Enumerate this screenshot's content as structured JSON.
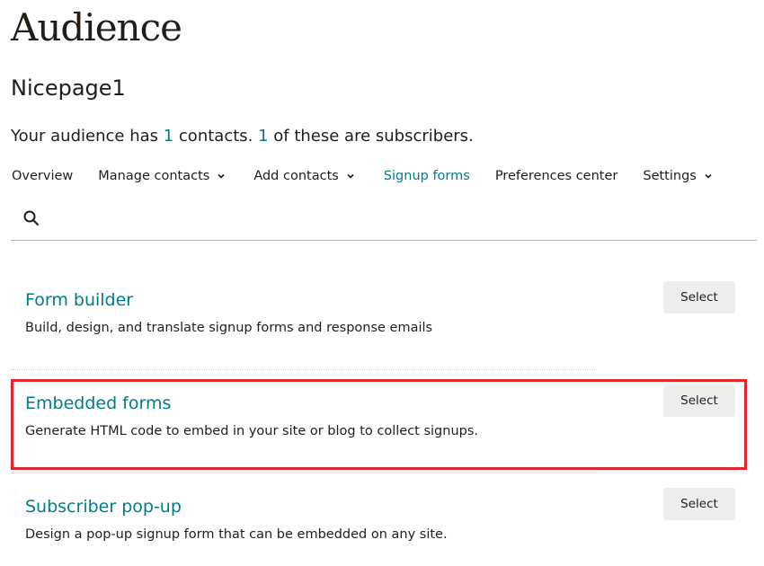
{
  "header": {
    "title": "Audience",
    "audience_name": "Nicepage1",
    "summary": {
      "prefix": "Your audience has ",
      "contacts": "1",
      "middle": " contacts. ",
      "subscribers": "1",
      "suffix": " of these are subscribers."
    }
  },
  "nav": {
    "items": [
      {
        "label": "Overview",
        "has_dropdown": false,
        "active": false
      },
      {
        "label": "Manage contacts",
        "has_dropdown": true,
        "active": false
      },
      {
        "label": "Add contacts",
        "has_dropdown": true,
        "active": false
      },
      {
        "label": "Signup forms",
        "has_dropdown": false,
        "active": true
      },
      {
        "label": "Preferences center",
        "has_dropdown": false,
        "active": false
      },
      {
        "label": "Settings",
        "has_dropdown": true,
        "active": false
      }
    ]
  },
  "search": {
    "icon": "search-icon"
  },
  "forms": [
    {
      "title": "Form builder",
      "description": "Build, design, and translate signup forms and response emails",
      "button": "Select"
    },
    {
      "title": "Embedded forms",
      "description": "Generate HTML code to embed in your site or blog to collect signups.",
      "button": "Select",
      "highlighted": true
    },
    {
      "title": "Subscriber pop-up",
      "description": "Design a pop-up signup form that can be embedded on any site.",
      "button": "Select"
    }
  ],
  "colors": {
    "accent": "#007c89",
    "text": "#241c15",
    "button_bg": "#efeeea",
    "highlight": "#e3262e"
  }
}
